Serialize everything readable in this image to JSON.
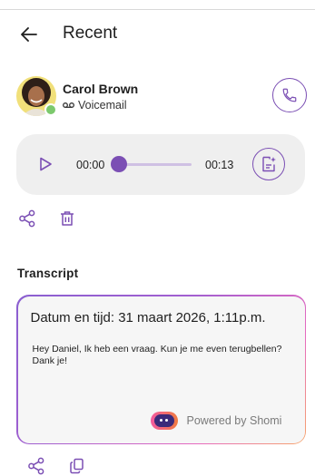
{
  "header": {
    "title": "Recent"
  },
  "contact": {
    "name": "Carol Brown",
    "type_label": "Voicemail"
  },
  "player": {
    "current_time": "00:00",
    "total_time": "00:13",
    "progress": 0
  },
  "transcript": {
    "section_title": "Transcript",
    "date_line": "Datum en tijd: 31 maart 2026, 1:11p.m.",
    "text": "Hey Daniel, Ik heb een vraag. Kun je me even terugbellen? Dank je!",
    "powered_by": "Powered by Shomi"
  },
  "colors": {
    "accent": "#7b4fb4",
    "status_online": "#7cc96d",
    "player_bg": "#efefef",
    "card_gradient": [
      "#8a5fd0",
      "#e66ac0",
      "#f7a56a"
    ]
  },
  "icons": {
    "back": "arrow-left-icon",
    "voicemail": "voicemail-icon",
    "call": "phone-icon",
    "play": "play-icon",
    "transcribe": "transcribe-icon",
    "share": "share-icon",
    "delete": "trash-icon",
    "copy": "copy-icon",
    "brand": "shomi-logo-icon"
  }
}
